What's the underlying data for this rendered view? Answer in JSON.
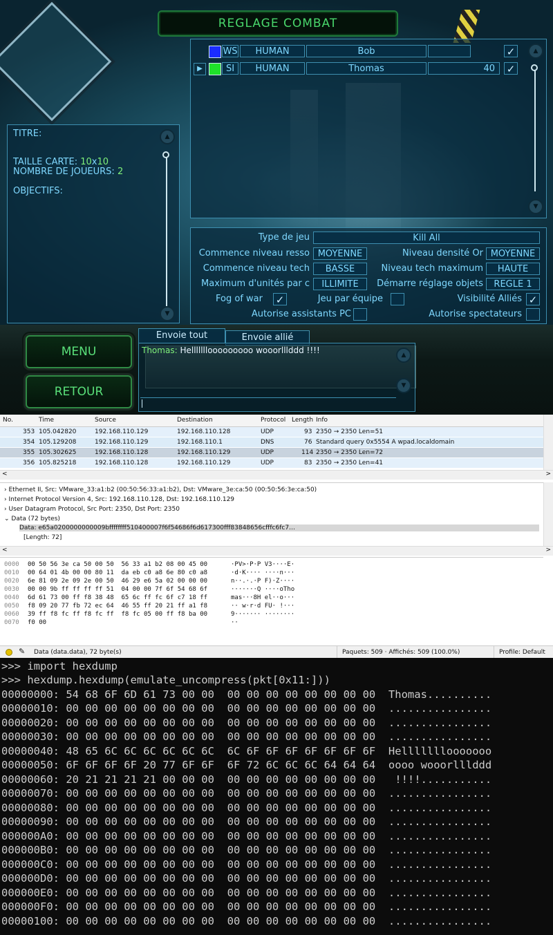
{
  "game": {
    "title": "REGLAGE COMBAT",
    "players": [
      {
        "team": "WS",
        "type": "HUMAN",
        "name": "Bob",
        "value": "",
        "color": "#1a2cff",
        "checked": true
      },
      {
        "team": "SI",
        "type": "HUMAN",
        "name": "Thomas",
        "value": "40",
        "color": "#1fe02a",
        "checked": true
      }
    ],
    "map_info": {
      "titre_label": "TITRE:",
      "taille_label": "TAILLE CARTE:",
      "taille_w": "10",
      "taille_x": "x",
      "taille_h": "10",
      "joueurs_label": "NOMBRE DE JOUEURS:",
      "joueurs_value": "2",
      "objectifs_label": "OBJECTIFS:"
    },
    "settings": {
      "type_jeu_label": "Type de jeu",
      "type_jeu_value": "Kill All",
      "niveau_resso_label": "Commence niveau resso",
      "niveau_resso_value": "MOYENNE",
      "densite_or_label": "Niveau densité Or",
      "densite_or_value": "MOYENNE",
      "niveau_tech_label": "Commence niveau tech",
      "niveau_tech_value": "BASSE",
      "tech_max_label": "Niveau tech maximum",
      "tech_max_value": "HAUTE",
      "max_unites_label": "Maximum d'unités par c",
      "max_unites_value": "ILLIMITE",
      "demarre_label": "Démarre réglage objets",
      "demarre_value": "REGLE 1",
      "fog_label": "Fog of war",
      "jeu_equipe_label": "Jeu par équipe",
      "visibilite_label": "Visibilité Alliés",
      "assistants_label": "Autorise assistants PC",
      "spectateurs_label": "Autorise spectateurs",
      "check_mark": "✓"
    },
    "menu_label": "MENU",
    "retour_label": "RETOUR",
    "chat": {
      "tab_all": "Envoie tout",
      "tab_ally": "Envoie allié",
      "sender": "Thomas:",
      "message": "Helllllllooooooooo wooorlllddd !!!!"
    }
  },
  "wireshark": {
    "columns": [
      "No.",
      "Time",
      "Source",
      "Destination",
      "Protocol",
      "Length",
      "Info"
    ],
    "packets": [
      {
        "no": "353",
        "time": "105.042820",
        "src": "192.168.110.129",
        "dst": "192.168.110.128",
        "proto": "UDP",
        "len": "93",
        "info": "2350 → 2350 Len=51"
      },
      {
        "no": "354",
        "time": "105.129208",
        "src": "192.168.110.129",
        "dst": "192.168.110.1",
        "proto": "DNS",
        "len": "76",
        "info": "Standard query 0x5554 A wpad.localdomain"
      },
      {
        "no": "355",
        "time": "105.302625",
        "src": "192.168.110.128",
        "dst": "192.168.110.129",
        "proto": "UDP",
        "len": "114",
        "info": "2350 → 2350 Len=72"
      },
      {
        "no": "356",
        "time": "105.825218",
        "src": "192.168.110.128",
        "dst": "192.168.110.129",
        "proto": "UDP",
        "len": "83",
        "info": "2350 → 2350 Len=41"
      }
    ],
    "details": [
      "Ethernet II, Src: VMware_33:a1:b2 (00:50:56:33:a1:b2), Dst: VMware_3e:ca:50 (00:50:56:3e:ca:50)",
      "Internet Protocol Version 4, Src: 192.168.110.128, Dst: 192.168.110.129",
      "User Datagram Protocol, Src Port: 2350, Dst Port: 2350",
      "Data (72 bytes)"
    ],
    "data_line": "Data: e65a0200000000009bffffffff510400007f6f54686f6d617300fff83848656cfffc6fc7…",
    "length_line": "[Length: 72]",
    "hex": [
      {
        "off": "0000",
        "bytes": "00 50 56 3e ca 50 00 50  56 33 a1 b2 08 00 45 00",
        "ascii": "·PV>·P·P V3····E·"
      },
      {
        "off": "0010",
        "bytes": "00 64 01 4b 00 00 80 11  da eb c0 a8 6e 80 c0 a8",
        "ascii": "·d·K···· ····n···"
      },
      {
        "off": "0020",
        "bytes": "6e 81 09 2e 09 2e 00 50  46 29 e6 5a 02 00 00 00",
        "ascii": "n··.·.·P F)·Z····"
      },
      {
        "off": "0030",
        "bytes": "00 00 9b ff ff ff ff 51  04 00 00 7f 6f 54 68 6f",
        "ascii": "·······Q ····oTho"
      },
      {
        "off": "0040",
        "bytes": "6d 61 73 00 ff f8 38 48  65 6c ff fc 6f c7 18 ff",
        "ascii": "mas···8H el··o···"
      },
      {
        "off": "0050",
        "bytes": "f8 09 20 77 fb 72 ec 64  46 55 ff 20 21 ff a1 f8",
        "ascii": "·· w·r·d FU· !···"
      },
      {
        "off": "0060",
        "bytes": "39 ff f8 fc ff f8 fc ff  f8 fc 05 00 ff f8 ba 00",
        "ascii": "9······· ········"
      },
      {
        "off": "0070",
        "bytes": "f0 00",
        "ascii": "··"
      }
    ],
    "status_left": "Data (data.data), 72 byte(s)",
    "status_mid": "Paquets: 509 · Affichés: 509 (100.0%)",
    "status_right": "Profile: Default"
  },
  "terminal": {
    "lines": [
      ">>> import hexdump",
      ">>> hexdump.hexdump(emulate_uncompress(pkt[0x11:]))",
      "00000000: 54 68 6F 6D 61 73 00 00  00 00 00 00 00 00 00 00  Thomas..........",
      "00000010: 00 00 00 00 00 00 00 00  00 00 00 00 00 00 00 00  ................",
      "00000020: 00 00 00 00 00 00 00 00  00 00 00 00 00 00 00 00  ................",
      "00000030: 00 00 00 00 00 00 00 00  00 00 00 00 00 00 00 00  ................",
      "00000040: 48 65 6C 6C 6C 6C 6C 6C  6C 6F 6F 6F 6F 6F 6F 6F  Helllllllooooooo",
      "00000050: 6F 6F 6F 6F 20 77 6F 6F  6F 72 6C 6C 6C 64 64 64  oooo wooorlllddd",
      "00000060: 20 21 21 21 21 00 00 00  00 00 00 00 00 00 00 00   !!!!...........",
      "00000070: 00 00 00 00 00 00 00 00  00 00 00 00 00 00 00 00  ................",
      "00000080: 00 00 00 00 00 00 00 00  00 00 00 00 00 00 00 00  ................",
      "00000090: 00 00 00 00 00 00 00 00  00 00 00 00 00 00 00 00  ................",
      "000000A0: 00 00 00 00 00 00 00 00  00 00 00 00 00 00 00 00  ................",
      "000000B0: 00 00 00 00 00 00 00 00  00 00 00 00 00 00 00 00  ................",
      "000000C0: 00 00 00 00 00 00 00 00  00 00 00 00 00 00 00 00  ................",
      "000000D0: 00 00 00 00 00 00 00 00  00 00 00 00 00 00 00 00  ................",
      "000000E0: 00 00 00 00 00 00 00 00  00 00 00 00 00 00 00 00  ................",
      "000000F0: 00 00 00 00 00 00 00 00  00 00 00 00 00 00 00 00  ................",
      "00000100: 00 00 00 00 00 00 00 00  00 00 00 00 00 00 00 00  ................"
    ]
  }
}
